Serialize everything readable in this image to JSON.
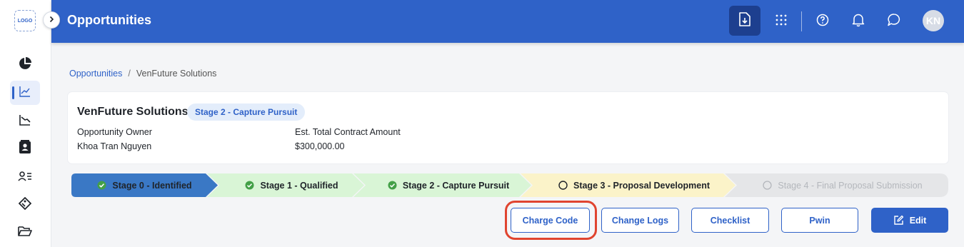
{
  "logo": {
    "text": "LOGO"
  },
  "header": {
    "title": "Opportunities",
    "avatar_initials": "KN"
  },
  "sidebar": {
    "items": [
      {
        "icon": "pie-chart-icon"
      },
      {
        "icon": "trend-chart-icon",
        "active": true
      },
      {
        "icon": "decline-chart-icon"
      },
      {
        "icon": "contact-card-icon"
      },
      {
        "icon": "people-list-icon"
      },
      {
        "icon": "tag-icon"
      },
      {
        "icon": "folder-open-icon"
      }
    ]
  },
  "breadcrumb": {
    "root": "Opportunities",
    "separator": "/",
    "current": "VenFuture Solutions"
  },
  "opportunity": {
    "name": "VenFuture Solutions",
    "stage_badge": "Stage 2 - Capture Pursuit",
    "owner_label": "Opportunity Owner",
    "owner_value": "Khoa Tran Nguyen",
    "amount_label": "Est. Total Contract Amount",
    "amount_value": "$300,000.00"
  },
  "stages": [
    {
      "label": "Stage 0 - Identified",
      "status": "current-done"
    },
    {
      "label": "Stage 1 - Qualified",
      "status": "done"
    },
    {
      "label": "Stage 2 - Capture Pursuit",
      "status": "done"
    },
    {
      "label": "Stage 3 - Proposal Development",
      "status": "in-progress"
    },
    {
      "label": "Stage 4 - Final Proposal Submission",
      "status": "pending"
    }
  ],
  "actions": {
    "charge_code": "Charge Code",
    "change_logs": "Change Logs",
    "checklist": "Checklist",
    "pwin": "Pwin",
    "edit": "Edit"
  },
  "colors": {
    "brand": "#2f62c8",
    "stage_blue": "#3a78c5",
    "stage_done": "#d9f5d6",
    "stage_progress": "#fbf3c9",
    "stage_pending": "#e5e6e8",
    "highlight": "#e0442f"
  }
}
